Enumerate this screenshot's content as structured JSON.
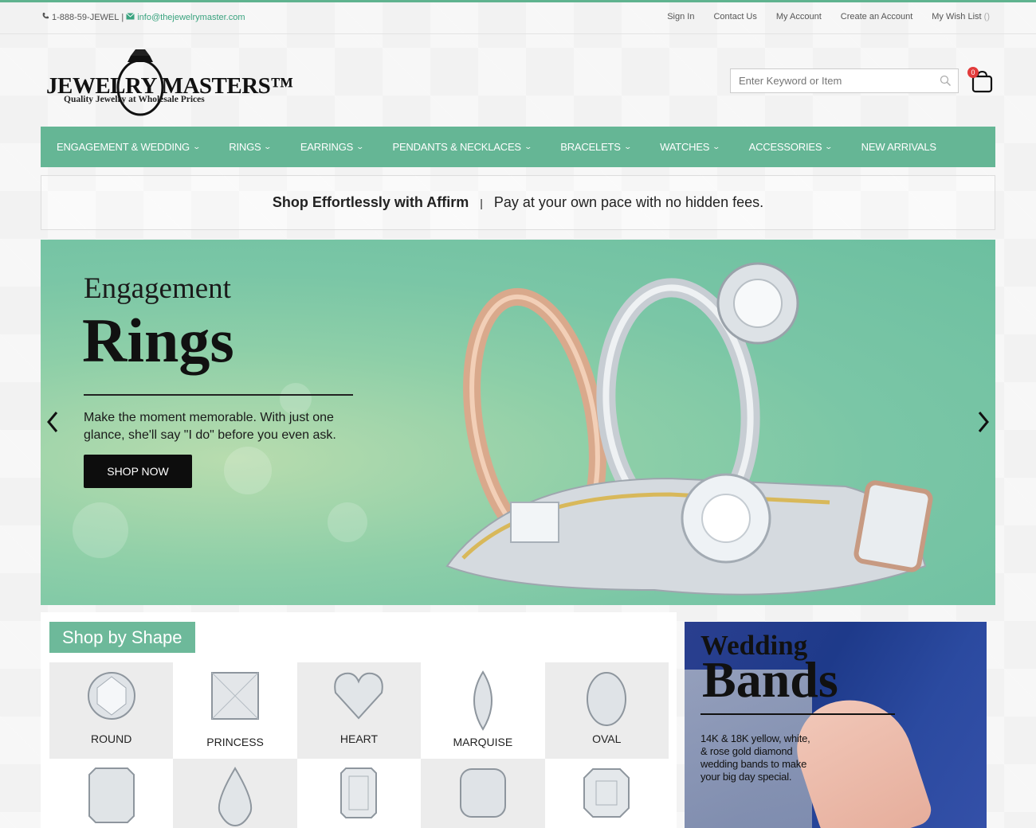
{
  "topbar": {
    "phone": "1-888-59-JEWEL",
    "separator": "|",
    "email": "info@thejewelrymaster.com",
    "links": [
      "Sign In",
      "Contact Us",
      "My Account",
      "Create an Account",
      "My Wish List"
    ],
    "wishlist_count": "()"
  },
  "logo": {
    "brand": "JEWELRY MASTERS™",
    "tagline": "Quality Jewelry at Wholesale Prices"
  },
  "search": {
    "placeholder": "Enter Keyword or Item"
  },
  "cart": {
    "count": "0"
  },
  "nav": [
    {
      "label": "ENGAGEMENT & WEDDING",
      "dropdown": true
    },
    {
      "label": "RINGS",
      "dropdown": true
    },
    {
      "label": "EARRINGS",
      "dropdown": true
    },
    {
      "label": "PENDANTS & NECKLACES",
      "dropdown": true
    },
    {
      "label": "BRACELETS",
      "dropdown": true
    },
    {
      "label": "WATCHES",
      "dropdown": true
    },
    {
      "label": "ACCESSORIES",
      "dropdown": true
    },
    {
      "label": "NEW ARRIVALS",
      "dropdown": false
    }
  ],
  "affirm": {
    "headline": "Shop Effortlessly with Affirm",
    "separator": "|",
    "text": "Pay at your own pace with no hidden fees."
  },
  "hero": {
    "title_small": "Engagement",
    "title_large": "Rings",
    "text": "Make the moment memorable. With just one glance, she'll say \"I do\" before you even ask.",
    "button": "SHOP NOW",
    "prev": "‹",
    "next": "›"
  },
  "shop_by_shape": {
    "title": "Shop by Shape",
    "shapes": [
      "ROUND",
      "PRINCESS",
      "HEART",
      "MARQUISE",
      "OVAL",
      "",
      "",
      "",
      "",
      ""
    ]
  },
  "wedding": {
    "title_small": "Wedding",
    "title_large": "Bands",
    "text": "14K & 18K yellow, white, & rose gold diamond wedding bands to make your big day special."
  },
  "colors": {
    "accent": "#65b695",
    "topline": "#5fb38f",
    "badge": "#e23b3b"
  }
}
